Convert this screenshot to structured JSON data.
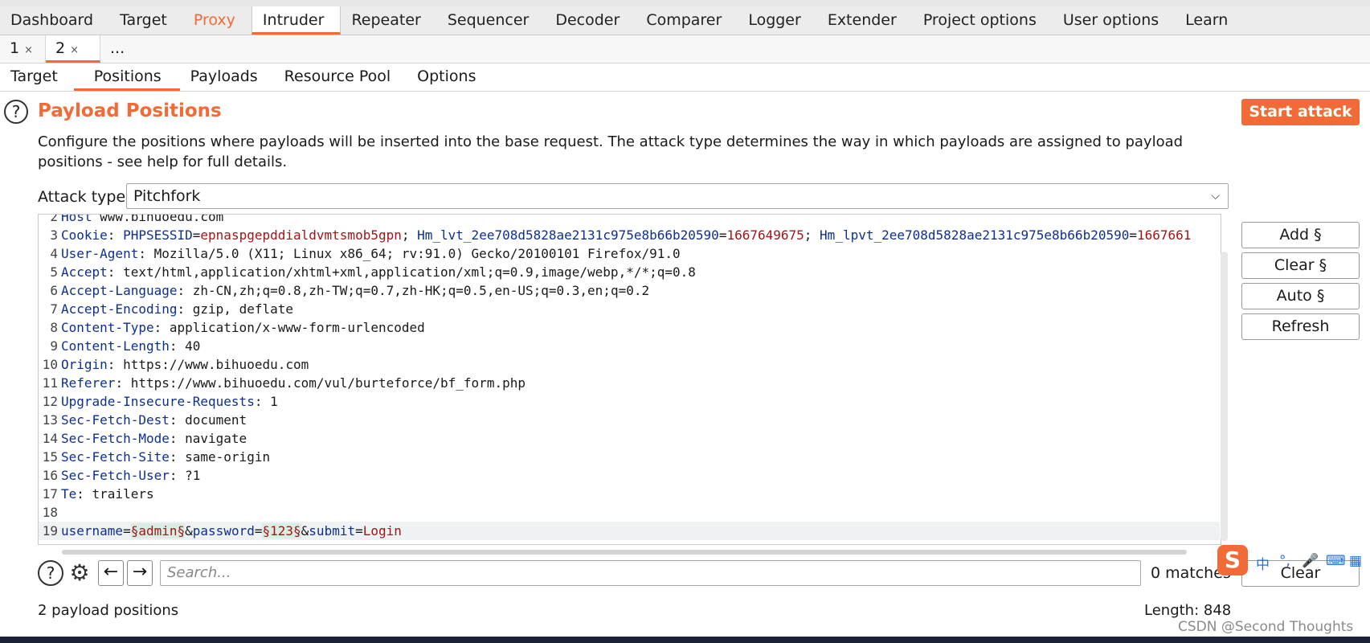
{
  "main_tabs": [
    "Dashboard",
    "Target",
    "Proxy",
    "Intruder",
    "Repeater",
    "Sequencer",
    "Decoder",
    "Comparer",
    "Logger",
    "Extender",
    "Project options",
    "User options",
    "Learn"
  ],
  "request_tabs": [
    {
      "label": "1",
      "close": "×"
    },
    {
      "label": "2",
      "close": "×"
    },
    {
      "label": "..."
    }
  ],
  "intruder_tabs": [
    "Target",
    "Positions",
    "Payloads",
    "Resource Pool",
    "Options"
  ],
  "section": {
    "help_glyph": "?",
    "title": "Payload Positions",
    "start_label": "Start attack",
    "description": "Configure the positions where payloads will be inserted into the base request. The attack type determines the way in which payloads are assigned to payload positions - see help for full details.",
    "attack_label": "Attack type:",
    "attack_value": "Pitchfork",
    "chevron": "⌵"
  },
  "request_lines": [
    {
      "n": "2",
      "key": "Host",
      "val": " www.bihuoedu.com"
    },
    {
      "n": "3",
      "key": "Cookie",
      "segs": [
        {
          "t": ": ",
          "c": "v"
        },
        {
          "t": "PHPSESSID",
          "c": "k"
        },
        {
          "t": "=",
          "c": "v"
        },
        {
          "t": "epnaspgepddialdvmtsmob5gpn",
          "c": "cv"
        },
        {
          "t": "; ",
          "c": "v"
        },
        {
          "t": "Hm_lvt_2ee708d5828ae2131c975e8b66b20590",
          "c": "k"
        },
        {
          "t": "=",
          "c": "v"
        },
        {
          "t": "1667649675",
          "c": "cv"
        },
        {
          "t": "; ",
          "c": "v"
        },
        {
          "t": "Hm_lpvt_2ee708d5828ae2131c975e8b66b20590",
          "c": "k"
        },
        {
          "t": "=",
          "c": "v"
        },
        {
          "t": "1667661",
          "c": "cv"
        }
      ]
    },
    {
      "n": "4",
      "key": "User-Agent",
      "val": ": Mozilla/5.0 (X11; Linux x86_64; rv:91.0) Gecko/20100101 Firefox/91.0"
    },
    {
      "n": "5",
      "key": "Accept",
      "val": ": text/html,application/xhtml+xml,application/xml;q=0.9,image/webp,*/*;q=0.8"
    },
    {
      "n": "6",
      "key": "Accept-Language",
      "val": ": zh-CN,zh;q=0.8,zh-TW;q=0.7,zh-HK;q=0.5,en-US;q=0.3,en;q=0.2"
    },
    {
      "n": "7",
      "key": "Accept-Encoding",
      "val": ": gzip, deflate"
    },
    {
      "n": "8",
      "key": "Content-Type",
      "val": ": application/x-www-form-urlencoded"
    },
    {
      "n": "9",
      "key": "Content-Length",
      "val": ": 40"
    },
    {
      "n": "10",
      "key": "Origin",
      "val": ": https://www.bihuoedu.com"
    },
    {
      "n": "11",
      "key": "Referer",
      "val": ": https://www.bihuoedu.com/vul/burteforce/bf_form.php"
    },
    {
      "n": "12",
      "key": "Upgrade-Insecure-Requests",
      "val": ": 1"
    },
    {
      "n": "13",
      "key": "Sec-Fetch-Dest",
      "val": ": document"
    },
    {
      "n": "14",
      "key": "Sec-Fetch-Mode",
      "val": ": navigate"
    },
    {
      "n": "15",
      "key": "Sec-Fetch-Site",
      "val": ": same-origin"
    },
    {
      "n": "16",
      "key": "Sec-Fetch-User",
      "val": ": ?1"
    },
    {
      "n": "17",
      "key": "Te",
      "val": ": trailers"
    },
    {
      "n": "18",
      "key": "",
      "val": ""
    },
    {
      "n": "19",
      "key": "",
      "segs": [
        {
          "t": "username",
          "c": "k"
        },
        {
          "t": "=",
          "c": "v"
        },
        {
          "t": "§admin§",
          "c": "payload"
        },
        {
          "t": "&",
          "c": "v"
        },
        {
          "t": "password",
          "c": "k"
        },
        {
          "t": "=",
          "c": "v"
        },
        {
          "t": "§123§",
          "c": "payload"
        },
        {
          "t": "&",
          "c": "v"
        },
        {
          "t": "submit",
          "c": "k"
        },
        {
          "t": "=",
          "c": "v"
        },
        {
          "t": "Login",
          "c": "cv"
        }
      ]
    }
  ],
  "side_buttons": [
    "Add §",
    "Clear §",
    "Auto §",
    "Refresh"
  ],
  "search": {
    "placeholder": "Search...",
    "matches": "0 matches",
    "clear_label": "Clear",
    "help_glyph": "?",
    "gear_glyph": "⚙",
    "back_glyph": "←",
    "forward_glyph": "→"
  },
  "ime": {
    "logo": "S",
    "lang": "中",
    "punct": "°,",
    "mic": "🎤",
    "keyboard": "⌨",
    "grid": "▦"
  },
  "footer": {
    "positions": "2 payload positions",
    "length": "Length: 848"
  },
  "watermark": "CSDN @Second Thoughts",
  "colors": {
    "accent": "#f26a35",
    "header_key": "#0d2f8f",
    "value_red": "#a31515",
    "payload_bg": "#d9ede4"
  }
}
